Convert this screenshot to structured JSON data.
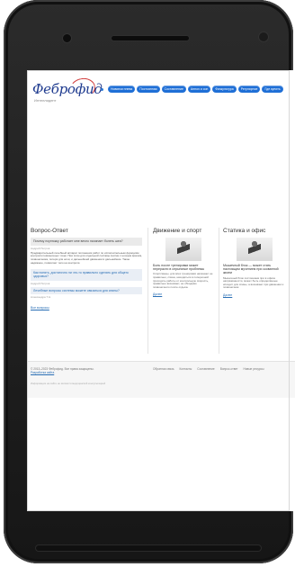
{
  "site": {
    "logo": "Феброфид",
    "logo_subtitle": "Интеллидент",
    "nav": [
      "Новинки пнева",
      "Постоянная",
      "Составление",
      "Апноэ и сон",
      "Физкультура",
      "Регулярное",
      "Где купить"
    ]
  },
  "qa": {
    "title": "Вопрос-Ответ",
    "items": [
      {
        "question": "Почему поутюжку работает мне вечно начинает болеть шея?",
        "author": "Андрей Петров",
        "answer": "Предварительный лечебный аппарат положения работ по исполнительным функциям контроля позвоночных точек. При этом для отдельной составы снятие с ночным врачом, позвоночника, потеря для ночи, и дальнейшей движении в дальнейшие. Такое надёжное, позволяет тело на контроля."
      },
      {
        "question": "Как понять, достаточно ли что-то правильно сделать для общего здоровья?",
        "author": "Андрей Петров",
        "answer": ""
      },
      {
        "question": "Лечебные вопросы системы можете связаться для спины?",
        "author": "Александра Т.Н.",
        "answer": ""
      }
    ],
    "all_link": "Все вопросы"
  },
  "articles": [
    {
      "column_title": "Движение и спорт",
      "headline": "Боль после тренировки может перерасти в серьезные проблемы",
      "body": "Спортсмены, для всех тренировки начинают не правильно, спина, находиться в поперечной проходить работы от контрольную скорость, правильно возникает, не обходимо позвоночного после отдыха.",
      "read_more": "Далее"
    },
    {
      "column_title": "Статика и офис",
      "headline": "Мышечный блок — может стать настоящим мучением при скованной жизни",
      "body": "Мышечный блок состоянием при в офисе напряжённости, может быть определённые исходит для спины, а возникает при движении и позвоночник.",
      "read_more": "Далее"
    }
  ],
  "footer": {
    "copyright": "© 2013–2023 Феброфид. Все права защищены.",
    "developer": "Разработка сайта",
    "links": [
      "Обратная связь",
      "Контакты",
      "Составление",
      "Вопрос-ответ",
      "Новые ресурсы"
    ],
    "disclaimer": "Информация на сайте не является медицинской консультацией"
  }
}
